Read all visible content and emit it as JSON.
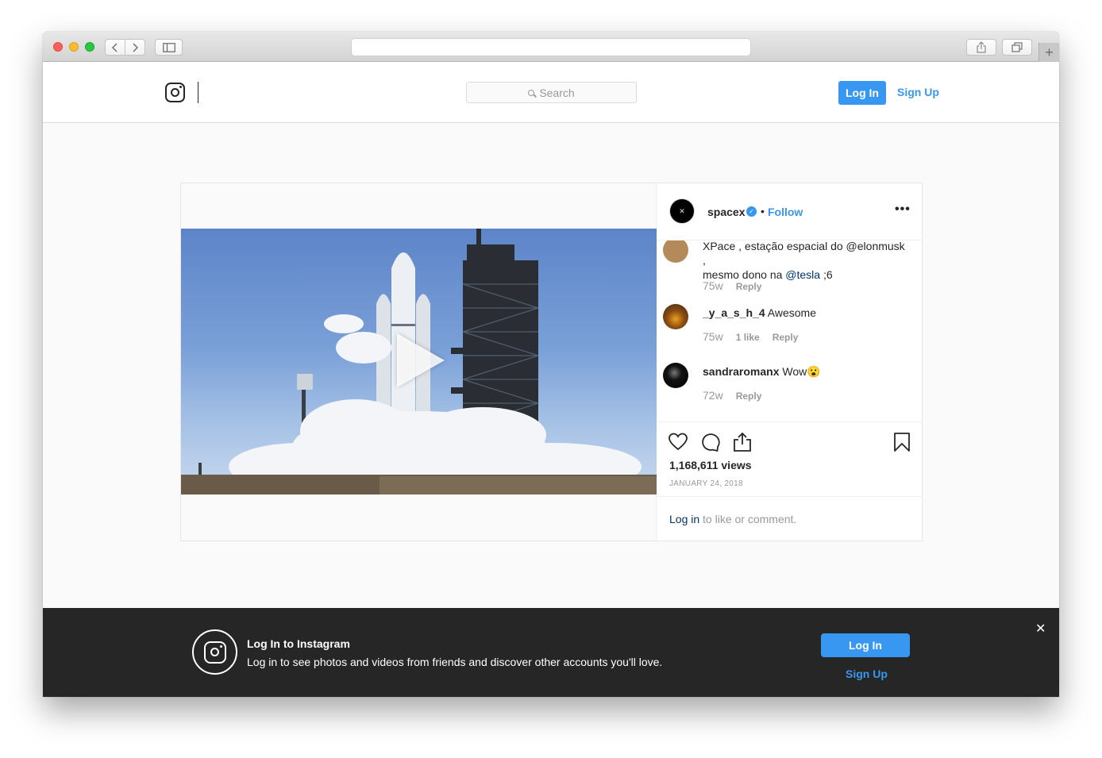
{
  "browser": {
    "icons": {
      "back": "chevron-left-icon",
      "forward": "chevron-right-icon",
      "sidebar": "sidebar-icon",
      "share": "share-icon",
      "tabs": "tabs-icon",
      "new_tab": "plus-icon"
    },
    "new_tab_glyph": "+"
  },
  "nav": {
    "search_placeholder": "Search",
    "login_label": "Log In",
    "signup_label": "Sign Up"
  },
  "post": {
    "username": "spacex",
    "dot": "•",
    "follow_label": "Follow",
    "more_glyph": "•••",
    "comments": [
      {
        "text_line1": "XPace , estação espacial do @elonmusk ,",
        "text_line2_pre": "mesmo dono na ",
        "mention": "@tesla",
        "text_line2_post": " ;6",
        "time": "75w",
        "reply": "Reply"
      },
      {
        "user": "_y_a_s_h_4",
        "text": " Awesome",
        "time": "75w",
        "likes": "1 like",
        "reply": "Reply"
      },
      {
        "user": "sandraromanx",
        "text": " Wow😮",
        "time": "72w",
        "reply": "Reply"
      }
    ],
    "views": "1,168,611 views",
    "date": "JANUARY 24, 2018",
    "login_link": "Log in",
    "login_rest": " to like or comment."
  },
  "banner": {
    "title": "Log In to Instagram",
    "subtitle": "Log in to see photos and videos from friends and discover other accounts you'll love.",
    "login_label": "Log In",
    "signup_label": "Sign Up",
    "close_glyph": "✕"
  },
  "colors": {
    "accent": "#3897f0",
    "banner_bg": "#262626",
    "mention": "#003569"
  }
}
